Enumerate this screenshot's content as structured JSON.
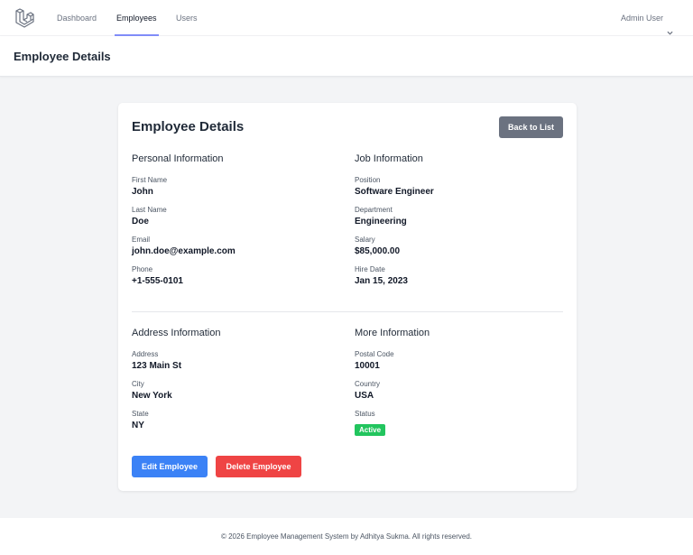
{
  "nav": {
    "links": [
      "Dashboard",
      "Employees",
      "Users"
    ],
    "active": "Employees",
    "user": "Admin User"
  },
  "header": {
    "title": "Employee Details"
  },
  "card": {
    "title": "Employee Details",
    "back_label": "Back to List",
    "personal": {
      "title": "Personal Information",
      "first_name_label": "First Name",
      "first_name": "John",
      "last_name_label": "Last Name",
      "last_name": "Doe",
      "email_label": "Email",
      "email": "john.doe@example.com",
      "phone_label": "Phone",
      "phone": "+1-555-0101"
    },
    "job": {
      "title": "Job Information",
      "position_label": "Position",
      "position": "Software Engineer",
      "department_label": "Department",
      "department": "Engineering",
      "salary_label": "Salary",
      "salary": "$85,000.00",
      "hire_date_label": "Hire Date",
      "hire_date": "Jan 15, 2023"
    },
    "address": {
      "title": "Address Information",
      "address_label": "Address",
      "address": "123 Main St",
      "city_label": "City",
      "city": "New York",
      "state_label": "State",
      "state": "NY"
    },
    "more": {
      "title": "More Information",
      "postal_label": "Postal Code",
      "postal": "10001",
      "country_label": "Country",
      "country": "USA",
      "status_label": "Status",
      "status": "Active"
    },
    "edit_label": "Edit Employee",
    "delete_label": "Delete Employee"
  },
  "footer": {
    "text": "© 2026 Employee Management System by Adhitya Sukma. All rights reserved."
  },
  "colors": {
    "accent_indicator": "#818cf8",
    "back_button": "#6b7280",
    "edit_button": "#3b82f6",
    "delete_button": "#ef4444",
    "status_active": "#22c55e"
  },
  "icons": {
    "logo": "laravel-logo-icon",
    "user_menu": "chevron-down-icon"
  }
}
